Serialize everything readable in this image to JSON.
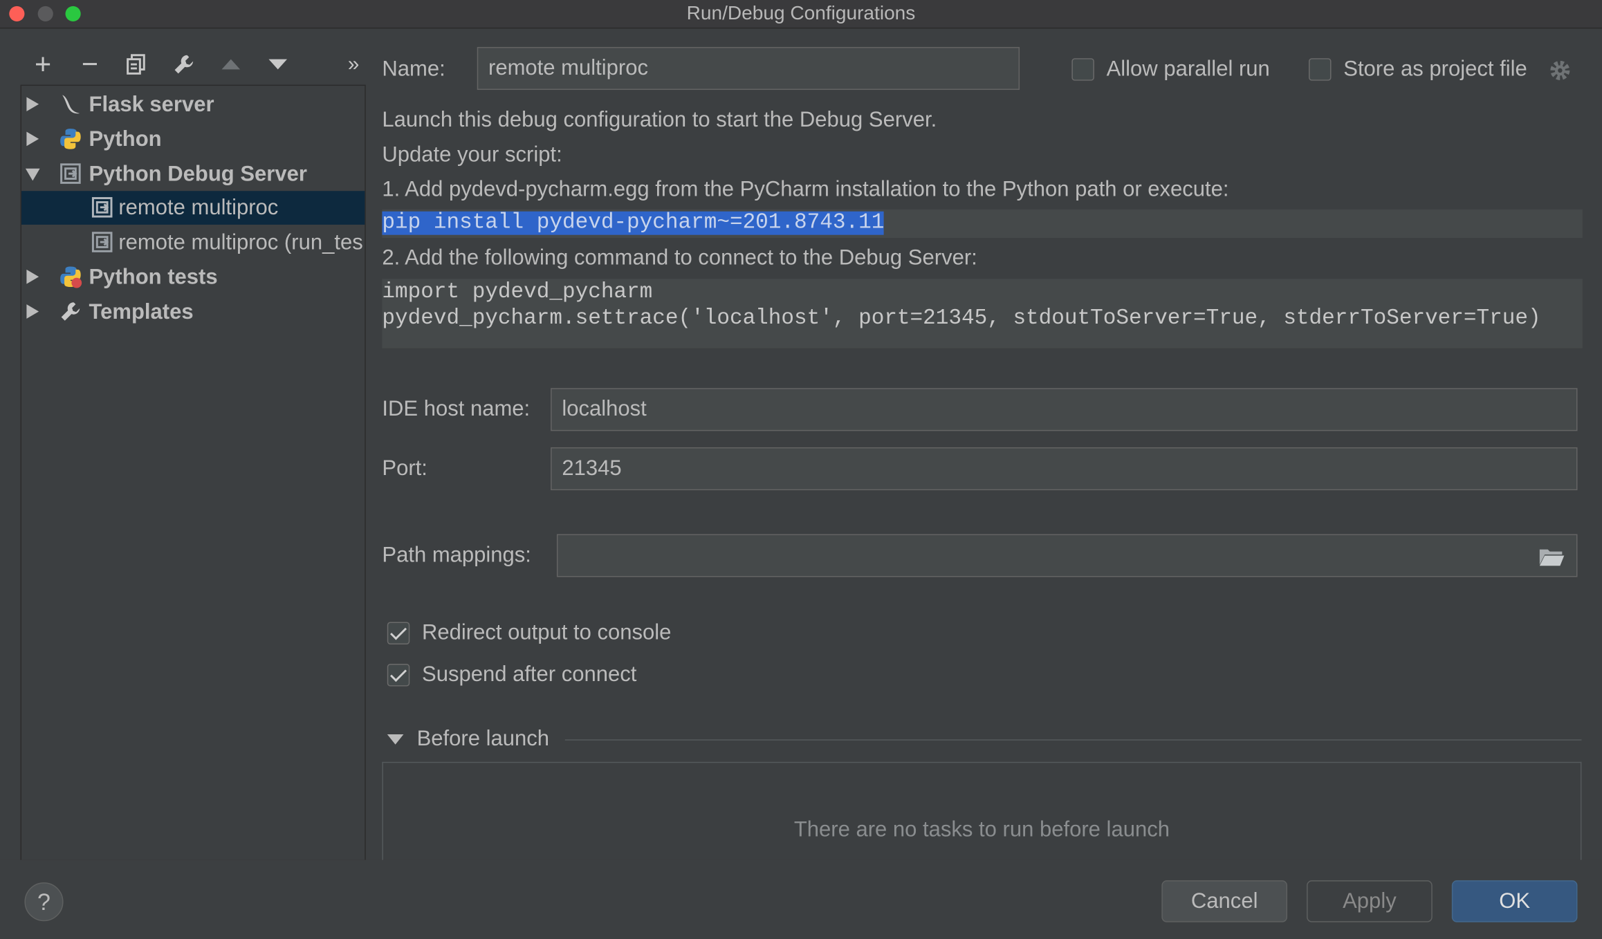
{
  "window": {
    "title": "Run/Debug Configurations"
  },
  "toolbar": {
    "add": "+",
    "remove": "−",
    "more": "»"
  },
  "tree": [
    {
      "label": "Flask server",
      "expanded": false,
      "bold": true,
      "icon": "flask-icon"
    },
    {
      "label": "Python",
      "expanded": false,
      "bold": true,
      "icon": "python-icon"
    },
    {
      "label": "Python Debug Server",
      "expanded": true,
      "bold": true,
      "icon": "debug-server-icon"
    },
    {
      "label": "remote multiproc",
      "child": true,
      "selected": true,
      "icon": "debug-config-icon"
    },
    {
      "label": "remote multiproc (run_tes",
      "child": true,
      "icon": "debug-config-icon"
    },
    {
      "label": "Python tests",
      "expanded": false,
      "bold": true,
      "icon": "python-tests-icon"
    },
    {
      "label": "Templates",
      "expanded": false,
      "bold": true,
      "icon": "wrench-icon"
    }
  ],
  "form": {
    "name_label": "Name:",
    "name_value": "remote multiproc",
    "allow_parallel_label": "Allow parallel run",
    "allow_parallel_checked": false,
    "store_project_label": "Store as project file",
    "store_project_checked": false,
    "info_line1": "Launch this debug configuration to start the Debug Server.",
    "info_line2": "Update your script:",
    "step1": "1. Add pydevd-pycharm.egg from the PyCharm installation to the Python path or execute:",
    "pip_cmd": "pip install pydevd-pycharm~=201.8743.11",
    "step2": "2. Add the following command to connect to the Debug Server:",
    "code_line1": "import pydevd_pycharm",
    "code_line2": "pydevd_pycharm.settrace('localhost', port=21345, stdoutToServer=True, stderrToServer=True)",
    "host_label": "IDE host name:",
    "host_value": "localhost",
    "port_label": "Port:",
    "port_value": "21345",
    "path_label": "Path mappings:",
    "path_value": "",
    "redirect_label": "Redirect output to console",
    "redirect_checked": true,
    "suspend_label": "Suspend after connect",
    "suspend_checked": true,
    "before_launch_label": "Before launch",
    "no_tasks": "There are no tasks to run before launch"
  },
  "buttons": {
    "help": "?",
    "cancel": "Cancel",
    "apply": "Apply",
    "ok": "OK"
  },
  "colors": {
    "background": "#3c3f41",
    "selection": "#0d293e",
    "highlight": "#2f65ca",
    "primary_button": "#365880"
  }
}
